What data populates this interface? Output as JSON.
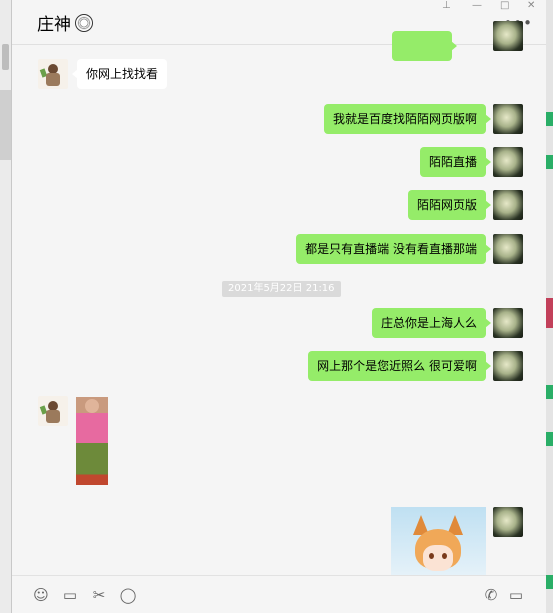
{
  "window": {
    "title": "庄神"
  },
  "colors": {
    "sent_bubble": "#95ec69",
    "received_bubble": "#ffffff",
    "chat_bg": "#f5f5f5"
  },
  "messages": [
    {
      "side": "left",
      "type": "text",
      "text": "你网上找找看"
    },
    {
      "side": "right",
      "type": "text",
      "text": "我就是百度找陌陌网页版啊"
    },
    {
      "side": "right",
      "type": "text",
      "text": "陌陌直播"
    },
    {
      "side": "right",
      "type": "text",
      "text": "陌陌网页版"
    },
    {
      "side": "right",
      "type": "text",
      "text": "都是只有直播端 没有看直播那端"
    },
    {
      "type": "timestamp",
      "text": "2021年5月22日 21:16"
    },
    {
      "side": "right",
      "type": "text",
      "text": "庄总你是上海人么"
    },
    {
      "side": "right",
      "type": "text",
      "text": "网上那个是您近照么 很可爱啊"
    },
    {
      "side": "left",
      "type": "image",
      "icon": "photo-of-child"
    },
    {
      "side": "right",
      "type": "image",
      "icon": "fox-girl-sticker"
    }
  ],
  "toolbar": {
    "left_icons": [
      "emoji-icon",
      "folder-icon",
      "scissors-icon",
      "chat-bubble-icon"
    ],
    "right_icons": [
      "phone-icon",
      "video-icon"
    ]
  }
}
